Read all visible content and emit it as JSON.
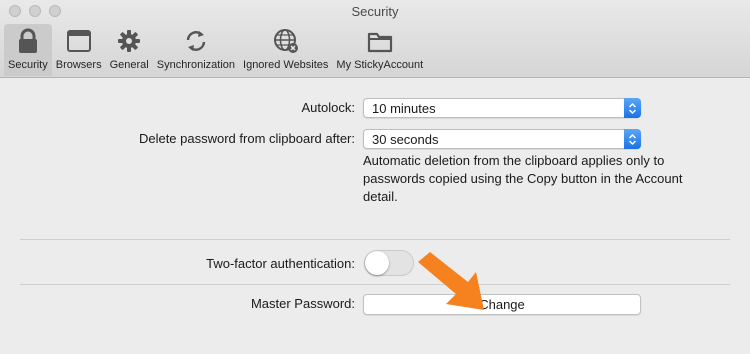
{
  "window": {
    "title": "Security"
  },
  "toolbar": {
    "items": [
      {
        "label": "Security",
        "icon": "lock-icon",
        "selected": true
      },
      {
        "label": "Browsers",
        "icon": "browser-window-icon",
        "selected": false
      },
      {
        "label": "General",
        "icon": "gear-icon",
        "selected": false
      },
      {
        "label": "Synchronization",
        "icon": "sync-icon",
        "selected": false
      },
      {
        "label": "Ignored Websites",
        "icon": "globe-blocked-icon",
        "selected": false
      },
      {
        "label": "My StickyAccount",
        "icon": "folder-icon",
        "selected": false
      }
    ]
  },
  "security": {
    "autolock": {
      "label": "Autolock:",
      "value": "10 minutes"
    },
    "clipboard": {
      "label": "Delete password from clipboard after:",
      "value": "30 seconds",
      "help": "Automatic deletion from the clipboard applies only to passwords copied using the Copy button in the Account detail."
    },
    "two_factor": {
      "label": "Two-factor authentication:",
      "enabled": false
    },
    "master_password": {
      "label": "Master Password:",
      "button_label": "Change"
    }
  },
  "colors": {
    "accent": "#1a72e8",
    "arrow": "#f5821f"
  }
}
